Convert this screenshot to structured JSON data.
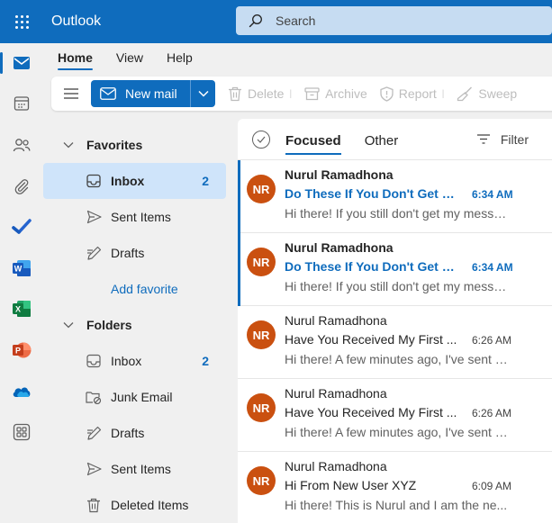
{
  "app": {
    "title": "Outlook"
  },
  "search": {
    "placeholder": "Search"
  },
  "ribbon": {
    "tabs": [
      {
        "label": "Home",
        "active": true
      },
      {
        "label": "View",
        "active": false
      },
      {
        "label": "Help",
        "active": false
      }
    ]
  },
  "toolbar": {
    "new_mail_label": "New mail",
    "delete_label": "Delete",
    "archive_label": "Archive",
    "report_label": "Report",
    "sweep_label": "Sweep"
  },
  "rail": {
    "items": [
      {
        "icon": "mail-icon",
        "active": true
      },
      {
        "icon": "calendar-icon"
      },
      {
        "icon": "people-icon"
      },
      {
        "icon": "attachment-icon"
      },
      {
        "icon": "todo-icon"
      },
      {
        "icon": "word-icon"
      },
      {
        "icon": "excel-icon"
      },
      {
        "icon": "powerpoint-icon"
      },
      {
        "icon": "onedrive-icon"
      },
      {
        "icon": "more-apps-icon"
      }
    ]
  },
  "folders": {
    "favorites_label": "Favorites",
    "favorites": [
      {
        "label": "Inbox",
        "count": "2",
        "icon": "inbox-icon",
        "selected": true
      },
      {
        "label": "Sent Items",
        "count": "",
        "icon": "send-icon"
      },
      {
        "label": "Drafts",
        "count": "",
        "icon": "drafts-icon"
      }
    ],
    "add_favorite_label": "Add favorite",
    "folders_label": "Folders",
    "items": [
      {
        "label": "Inbox",
        "count": "2",
        "icon": "inbox-icon"
      },
      {
        "label": "Junk Email",
        "count": "",
        "icon": "junk-icon"
      },
      {
        "label": "Drafts",
        "count": "",
        "icon": "drafts-icon"
      },
      {
        "label": "Sent Items",
        "count": "",
        "icon": "send-icon"
      },
      {
        "label": "Deleted Items",
        "count": "",
        "icon": "trash-icon"
      }
    ]
  },
  "message_list": {
    "tabs": [
      {
        "label": "Focused",
        "active": true
      },
      {
        "label": "Other",
        "active": false
      }
    ],
    "filter_label": "Filter",
    "messages": [
      {
        "initials": "NR",
        "sender": "Nurul Ramadhona",
        "subject": "Do These If You Don't Get M...",
        "time": "6:34 AM",
        "preview": "Hi there! If you still don't get my messa...",
        "unread": true
      },
      {
        "initials": "NR",
        "sender": "Nurul Ramadhona",
        "subject": "Do These If You Don't Get M...",
        "time": "6:34 AM",
        "preview": "Hi there! If you still don't get my messa...",
        "unread": true
      },
      {
        "initials": "NR",
        "sender": "Nurul Ramadhona",
        "subject": "Have You Received My First ...",
        "time": "6:26 AM",
        "preview": "Hi there! A few minutes ago, I've sent a...",
        "unread": false
      },
      {
        "initials": "NR",
        "sender": "Nurul Ramadhona",
        "subject": "Have You Received My First ...",
        "time": "6:26 AM",
        "preview": "Hi there! A few minutes ago, I've sent a...",
        "unread": false
      },
      {
        "initials": "NR",
        "sender": "Nurul Ramadhona",
        "subject": "Hi From New User XYZ",
        "time": "6:09 AM",
        "preview": "Hi there! This is Nurul and I am the ne...",
        "unread": false
      }
    ]
  },
  "colors": {
    "brand": "#0f6cbd",
    "avatar": "#ca5010",
    "selected": "#cfe4fa"
  }
}
